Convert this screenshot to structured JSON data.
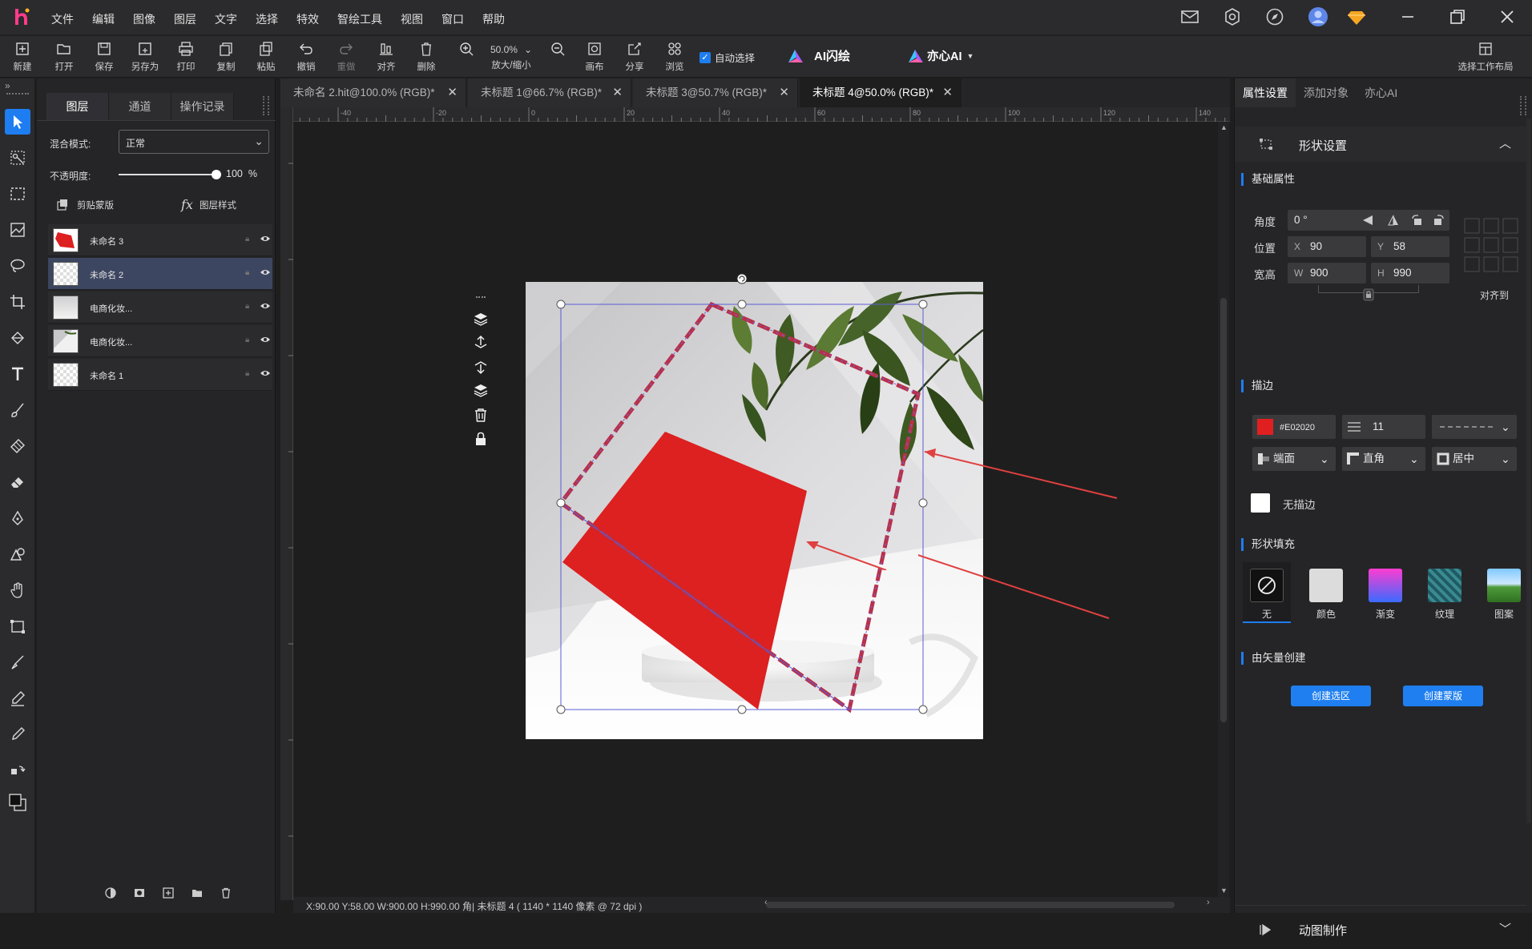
{
  "menu": [
    "文件",
    "编辑",
    "图像",
    "图层",
    "文字",
    "选择",
    "特效",
    "智绘工具",
    "视图",
    "窗口",
    "帮助"
  ],
  "toolbar": {
    "new": "新建",
    "open": "打开",
    "save": "保存",
    "save_as": "另存为",
    "print": "打印",
    "copy": "复制",
    "paste": "粘贴",
    "undo": "撤销",
    "redo": "重做",
    "align": "对齐",
    "delete": "删除",
    "zoom_value": "50.0%",
    "zoom_label": "放大/缩小",
    "canvas": "画布",
    "share": "分享",
    "browse": "浏览",
    "auto_select": "自动选择",
    "ai_flash": "AI闪绘",
    "yixin_ai": "亦心AI",
    "workspace": "选择工作布局"
  },
  "layers_panel": {
    "tabs": [
      "图层",
      "通道",
      "操作记录"
    ],
    "blend_label": "混合模式:",
    "blend_value": "正常",
    "opacity_label": "不透明度:",
    "opacity_value": "100",
    "opacity_unit": "%",
    "opacity_level": 1.0,
    "clip_mask": "剪贴蒙版",
    "layer_style": "图层样式",
    "layers": [
      {
        "name": "未命名 3",
        "thumb": "red"
      },
      {
        "name": "未命名 2",
        "thumb": "checker",
        "selected": true
      },
      {
        "name": "电商化妆...",
        "thumb": "photo"
      },
      {
        "name": "电商化妆...",
        "thumb": "photo2"
      },
      {
        "name": "未命名 1",
        "thumb": "checker"
      }
    ]
  },
  "doc_tabs": [
    {
      "label": "未命名 2.hit@100.0% (RGB)*",
      "active": false
    },
    {
      "label": "未标题 1@66.7% (RGB)*",
      "active": false
    },
    {
      "label": "未标题 3@50.7% (RGB)*",
      "active": false
    },
    {
      "label": "未标题 4@50.0% (RGB)*",
      "active": true
    }
  ],
  "ruler_marks": [
    "-40",
    "-20",
    "0",
    "20",
    "40",
    "60",
    "80",
    "100",
    "120",
    "140"
  ],
  "status": {
    "text": "X:90.00 Y:58.00 W:900.00 H:990.00 角|  未标题 4 ( 1140 * 1140 像素 @ 72 dpi )"
  },
  "right_panel": {
    "tabs": [
      "属性设置",
      "添加对象",
      "亦心AI"
    ],
    "shape_settings": "形状设置",
    "basic_props": "基础属性",
    "angle_label": "角度",
    "angle_value": "0 °",
    "position_label": "位置",
    "x_label": "X",
    "x_value": "90",
    "y_label": "Y",
    "y_value": "58",
    "size_label": "宽高",
    "w_label": "W",
    "w_value": "900",
    "h_label": "H",
    "h_value": "990",
    "align_to": "对齐到",
    "stroke_title": "描边",
    "stroke_color": "#E02020",
    "stroke_color_label": "#E02020",
    "stroke_width": "11",
    "cap_label": "端面",
    "join_label": "直角",
    "pos_label": "居中",
    "no_stroke": "无描边",
    "fill_title": "形状填充",
    "fill_options": [
      "无",
      "颜色",
      "渐变",
      "纹理",
      "图案"
    ],
    "vector_title": "由矢量创建",
    "create_selection": "创建选区",
    "create_mask": "创建蒙版",
    "animation": "动图制作"
  },
  "colors": {
    "accent": "#1e7df0",
    "shape_red": "#dd2020",
    "selection": "#5b5bd6"
  }
}
